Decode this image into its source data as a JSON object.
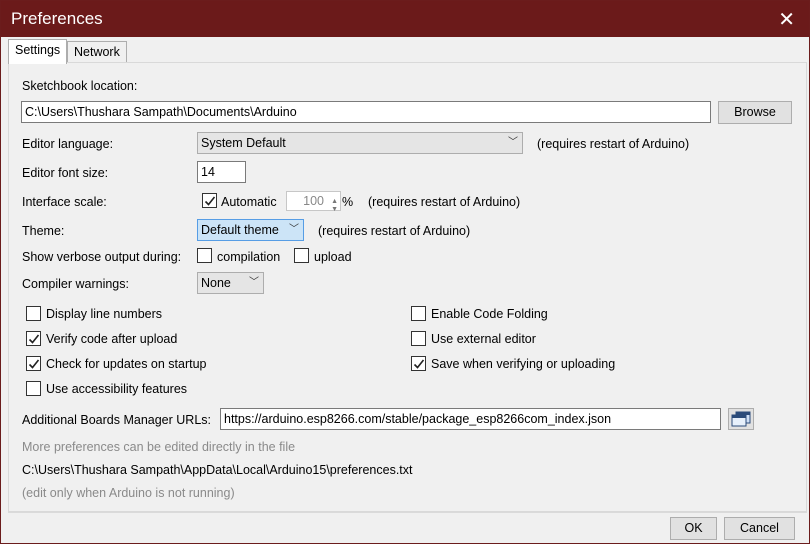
{
  "window": {
    "title": "Preferences"
  },
  "tabs": [
    "Settings",
    "Network"
  ],
  "sketchbook": {
    "label": "Sketchbook location:",
    "path": "C:\\Users\\Thushara Sampath\\Documents\\Arduino",
    "browse": "Browse"
  },
  "editor_language": {
    "label": "Editor language:",
    "value": "System Default",
    "note": "(requires restart of Arduino)"
  },
  "editor_font_size": {
    "label": "Editor font size:",
    "value": "14"
  },
  "interface_scale": {
    "label": "Interface scale:",
    "automatic_label": "Automatic",
    "automatic_checked": true,
    "value": "100",
    "unit": "%",
    "note": "(requires restart of Arduino)"
  },
  "theme": {
    "label": "Theme:",
    "value": "Default theme",
    "note": "(requires restart of Arduino)"
  },
  "verbose": {
    "label": "Show verbose output during:",
    "compilation": "compilation",
    "upload": "upload"
  },
  "compiler_warnings": {
    "label": "Compiler warnings:",
    "value": "None"
  },
  "options_left": [
    {
      "label": "Display line numbers",
      "checked": false
    },
    {
      "label": "Verify code after upload",
      "checked": true
    },
    {
      "label": "Check for updates on startup",
      "checked": true
    },
    {
      "label": "Use accessibility features",
      "checked": false
    }
  ],
  "options_right": [
    {
      "label": "Enable Code Folding",
      "checked": false
    },
    {
      "label": "Use external editor",
      "checked": false
    },
    {
      "label": "Save when verifying or uploading",
      "checked": true
    }
  ],
  "boards": {
    "label": "Additional Boards Manager URLs:",
    "value": "https://arduino.esp8266.com/stable/package_esp8266com_index.json"
  },
  "info": {
    "more_prefs": "More preferences can be edited directly in the file",
    "prefs_path": "C:\\Users\\Thushara Sampath\\AppData\\Local\\Arduino15\\preferences.txt",
    "edit_note": "(edit only when Arduino is not running)"
  },
  "buttons": {
    "ok": "OK",
    "cancel": "Cancel"
  },
  "colors": {
    "titlebar": "#6b1a1a",
    "accent": "#569de5"
  }
}
